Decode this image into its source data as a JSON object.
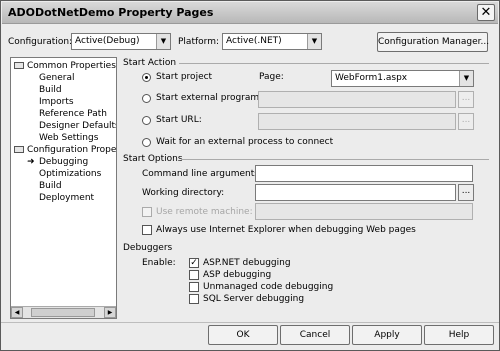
{
  "window": {
    "title": "ADODotNetDemo Property Pages"
  },
  "top": {
    "configuration_label": "Configuration:",
    "configuration_value": "Active(Debug)",
    "platform_label": "Platform:",
    "platform_value": "Active(.NET)",
    "config_manager_label": "Configuration Manager..."
  },
  "tree": {
    "common_properties": "Common Properties",
    "common_items": [
      "General",
      "Build",
      "Imports",
      "Reference Path",
      "Designer Defaults",
      "Web Settings"
    ],
    "configuration_properties": "Configuration Properties",
    "config_items": [
      "Debugging",
      "Optimizations",
      "Build",
      "Deployment"
    ]
  },
  "start_action": {
    "heading": "Start Action",
    "start_project": "Start project",
    "page_label": "Page:",
    "page_value": "WebForm1.aspx",
    "start_external_program": "Start external program:",
    "start_url": "Start URL:",
    "wait_external": "Wait for an external process to connect"
  },
  "start_options": {
    "heading": "Start Options",
    "cmdline_label": "Command line arguments:",
    "workdir_label": "Working directory:",
    "use_remote_label": "Use remote machine:",
    "always_ie_label": "Always use Internet Explorer when debugging Web pages"
  },
  "debuggers": {
    "heading": "Debuggers",
    "enable_label": "Enable:",
    "aspnet": "ASP.NET debugging",
    "asp": "ASP debugging",
    "unmanaged": "Unmanaged code debugging",
    "sql": "SQL Server debugging"
  },
  "buttons": {
    "ok": "OK",
    "cancel": "Cancel",
    "apply": "Apply",
    "help": "Help"
  },
  "glyphs": {
    "close": "✕",
    "down_arrow": "▼",
    "ellipsis": "...",
    "check": "✓",
    "selected_arrow": "➜",
    "left": "◀",
    "right": "▶"
  }
}
